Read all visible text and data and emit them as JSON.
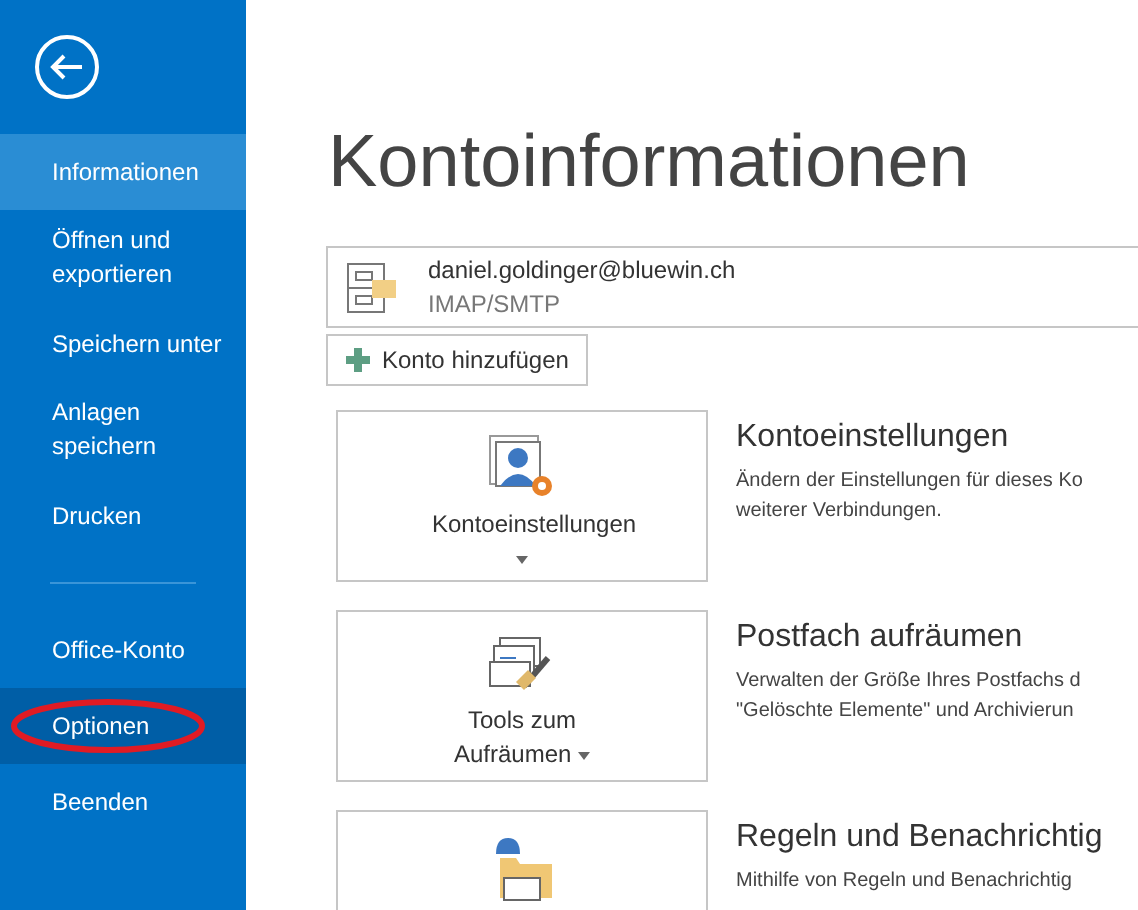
{
  "sidebar": {
    "items": [
      {
        "label": "Informationen",
        "selected": true,
        "hover": false
      },
      {
        "label": "Öffnen und exportieren",
        "selected": false,
        "hover": false
      },
      {
        "label": "Speichern unter",
        "selected": false,
        "hover": false
      },
      {
        "label": "Anlagen speichern",
        "selected": false,
        "hover": false
      },
      {
        "label": "Drucken",
        "selected": false,
        "hover": false
      },
      {
        "label": "Office-Konto",
        "selected": false,
        "hover": false
      },
      {
        "label": "Optionen",
        "selected": false,
        "hover": true,
        "circled": true
      },
      {
        "label": "Beenden",
        "selected": false,
        "hover": false
      }
    ]
  },
  "page_title": "Kontoinformationen",
  "account": {
    "email": "daniel.goldinger@bluewin.ch",
    "type": "IMAP/SMTP"
  },
  "add_account_button": "Konto hinzufügen",
  "sections": [
    {
      "kind": "settings",
      "button": "Kontoeinstellungen",
      "title": "Kontoeinstellungen",
      "description": "Ändern der Einstellungen für dieses Ko weiterer Verbindungen."
    },
    {
      "kind": "cleanup",
      "button": "Tools zum Aufräumen",
      "title": "Postfach aufräumen",
      "description": "Verwalten der Größe Ihres Postfachs d \"Gelöschte Elemente\" und Archivierun"
    },
    {
      "kind": "rules",
      "title": "Regeln und Benachrichtig",
      "description": "Mithilfe von Regeln und Benachrichtig"
    }
  ]
}
